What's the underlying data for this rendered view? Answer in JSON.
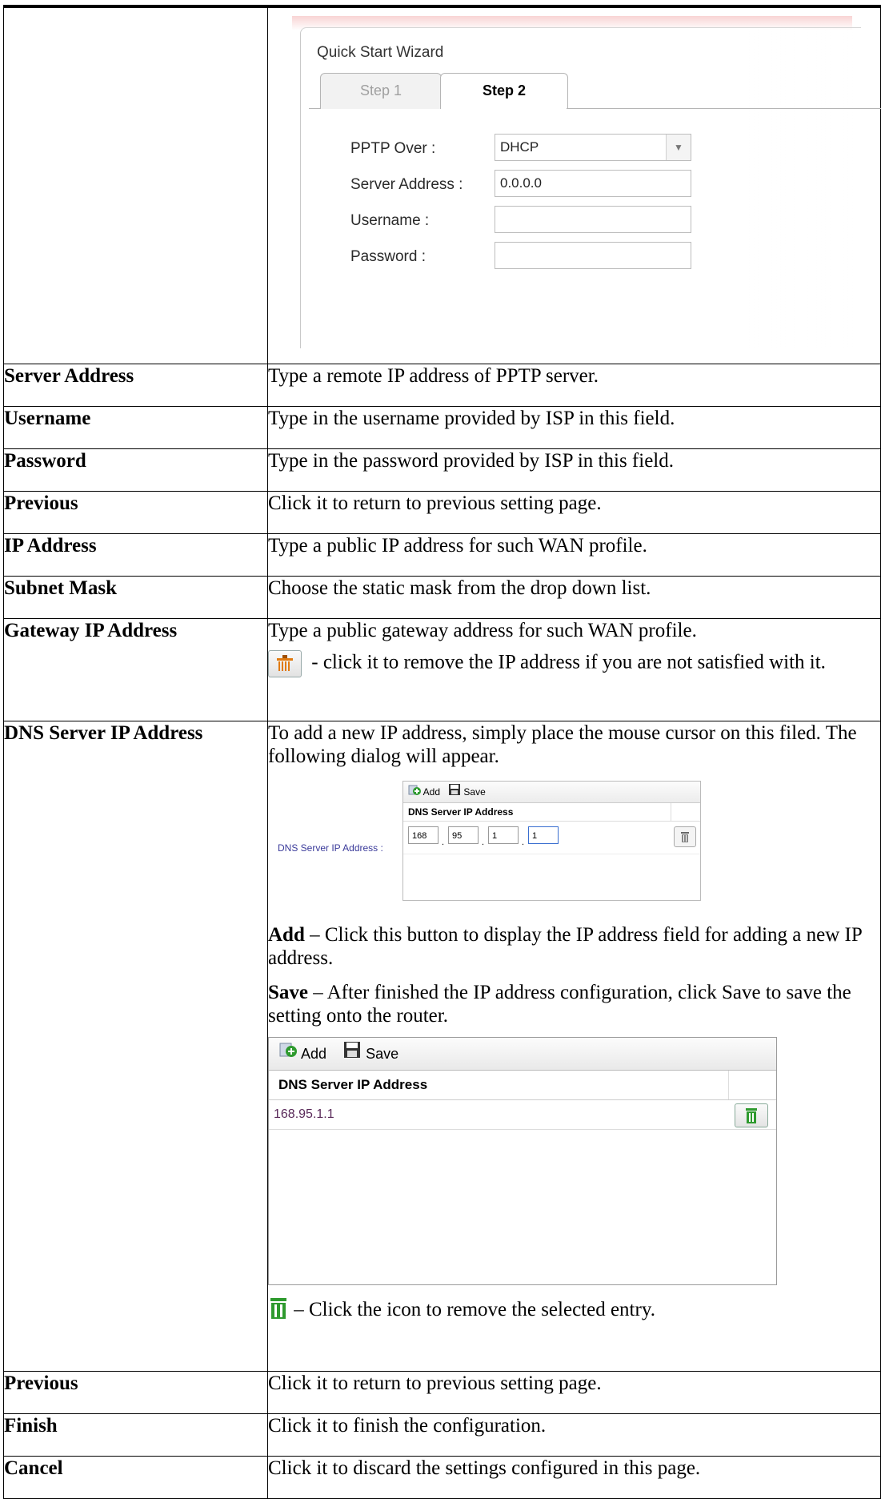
{
  "wizard": {
    "title": "Quick Start Wizard",
    "tabs": [
      {
        "label": "Step 1"
      },
      {
        "label": "Step 2"
      }
    ],
    "fields": [
      {
        "label": "PPTP Over :",
        "value": "DHCP"
      },
      {
        "label": "Server Address :",
        "value": "0.0.0.0"
      },
      {
        "label": "Username :",
        "value": ""
      },
      {
        "label": "Password :",
        "value": ""
      }
    ]
  },
  "rows": [
    {
      "term": "Server Address",
      "desc": "Type a remote IP address of PPTP server."
    },
    {
      "term": "Username",
      "desc": "Type in the username provided by ISP in this field."
    },
    {
      "term": "Password",
      "desc": "Type in the password provided by ISP in this field."
    },
    {
      "term": "Previous",
      "desc": "Click it to return to previous setting page."
    },
    {
      "term": "IP Address",
      "desc": "Type a public IP address for such WAN profile."
    },
    {
      "term": "Subnet Mask",
      "desc": "Choose the static mask from the drop down list."
    }
  ],
  "gateway": {
    "term": "Gateway IP Address",
    "desc": "Type a public gateway address for such WAN profile.",
    "remove_note": " - click it to remove the IP address if you are not satisfied with it."
  },
  "dns": {
    "term": "DNS Server IP Address",
    "intro": "To add a new IP address, simply place the mouse cursor on this filed. The following dialog will appear.",
    "small_dialog": {
      "field_label": "DNS Server IP Address :",
      "add_label": "Add",
      "save_label": "Save",
      "column_header": "DNS Server IP Address",
      "octets": [
        "168",
        "95",
        "1",
        "1"
      ]
    },
    "add_term": "Add",
    "add_desc": " – Click this button to display the IP address field for adding a new IP address.",
    "save_term": "Save",
    "save_desc": " – After finished the IP address configuration, click Save to save the setting onto the router.",
    "big_dialog": {
      "add_label": "Add",
      "save_label": "Save",
      "column_header": "DNS Server IP Address",
      "entry": "168.95.1.1"
    },
    "remove_desc": " – Click the icon to remove the selected entry."
  },
  "bottom_rows": [
    {
      "term": "Previous",
      "desc": "Click it to return to previous setting page."
    },
    {
      "term": "Finish",
      "desc": "Click it to finish the configuration."
    },
    {
      "term": "Cancel",
      "desc": "Click it to discard the settings configured in this page."
    }
  ],
  "colors": {
    "trash_green": "#2e9a2e",
    "trash_orange": "#e07a10"
  }
}
